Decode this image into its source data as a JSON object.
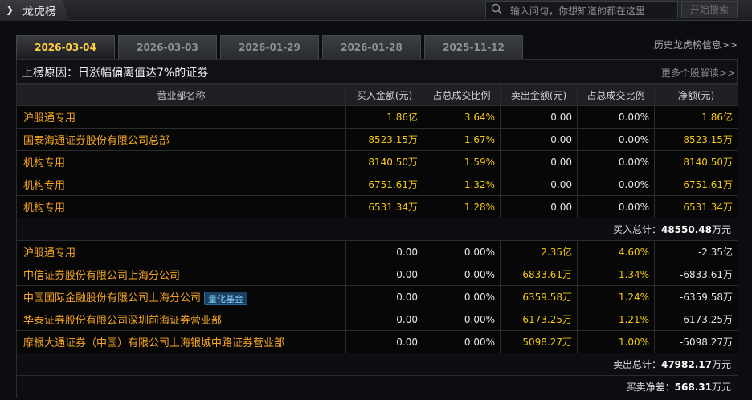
{
  "app": {
    "title": "龙虎榜"
  },
  "search": {
    "placeholder": "输入问句，你想知道的都在这里",
    "button": "开始搜索"
  },
  "date_tabs": [
    "2026-03-04",
    "2026-03-03",
    "2026-01-29",
    "2026-01-28",
    "2025-11-12"
  ],
  "active_tab": 0,
  "history_link": "历史龙虎榜信息>>",
  "reason": {
    "label": "上榜原因：日涨幅偏离值达7%的证券",
    "more": "更多个股解读>>"
  },
  "table": {
    "headers": [
      "营业部名称",
      "买入金额(元)",
      "占总成交比例",
      "卖出金额(元)",
      "占总成交比例",
      "净额(元)"
    ],
    "buy_rows": [
      {
        "name": "沪股通专用",
        "buy": "1.86亿",
        "buy_pct": "3.64%",
        "sell": "0.00",
        "sell_pct": "0.00%",
        "net": "1.86亿"
      },
      {
        "name": "国泰海通证券股份有限公司总部",
        "buy": "8523.15万",
        "buy_pct": "1.67%",
        "sell": "0.00",
        "sell_pct": "0.00%",
        "net": "8523.15万"
      },
      {
        "name": "机构专用",
        "buy": "8140.50万",
        "buy_pct": "1.59%",
        "sell": "0.00",
        "sell_pct": "0.00%",
        "net": "8140.50万"
      },
      {
        "name": "机构专用",
        "buy": "6751.61万",
        "buy_pct": "1.32%",
        "sell": "0.00",
        "sell_pct": "0.00%",
        "net": "6751.61万"
      },
      {
        "name": "机构专用",
        "buy": "6531.34万",
        "buy_pct": "1.28%",
        "sell": "0.00",
        "sell_pct": "0.00%",
        "net": "6531.34万"
      }
    ],
    "buy_total": {
      "label": "买入总计：",
      "value": "48550.48",
      "unit": "万元"
    },
    "sell_rows": [
      {
        "name": "沪股通专用",
        "tag": "",
        "buy": "0.00",
        "buy_pct": "0.00%",
        "sell": "2.35亿",
        "sell_pct": "4.60%",
        "net": "-2.35亿"
      },
      {
        "name": "中信证券股份有限公司上海分公司",
        "tag": "",
        "buy": "0.00",
        "buy_pct": "0.00%",
        "sell": "6833.61万",
        "sell_pct": "1.34%",
        "net": "-6833.61万"
      },
      {
        "name": "中国国际金融股份有限公司上海分公司",
        "tag": "量化基金",
        "buy": "0.00",
        "buy_pct": "0.00%",
        "sell": "6359.58万",
        "sell_pct": "1.24%",
        "net": "-6359.58万"
      },
      {
        "name": "华泰证券股份有限公司深圳前海证券营业部",
        "tag": "",
        "buy": "0.00",
        "buy_pct": "0.00%",
        "sell": "6173.25万",
        "sell_pct": "1.21%",
        "net": "-6173.25万"
      },
      {
        "name": "摩根大通证券（中国）有限公司上海银城中路证券营业部",
        "tag": "",
        "buy": "0.00",
        "buy_pct": "0.00%",
        "sell": "5098.27万",
        "sell_pct": "1.00%",
        "net": "-5098.27万"
      }
    ],
    "sell_total": {
      "label": "卖出总计：",
      "value": "47982.17",
      "unit": "万元"
    },
    "net_total": {
      "label": "买卖净差：",
      "value": "568.31",
      "unit": "万元"
    }
  },
  "colors": {
    "accent": "#f2c811",
    "name": "#f5a623",
    "background": "#070708"
  }
}
